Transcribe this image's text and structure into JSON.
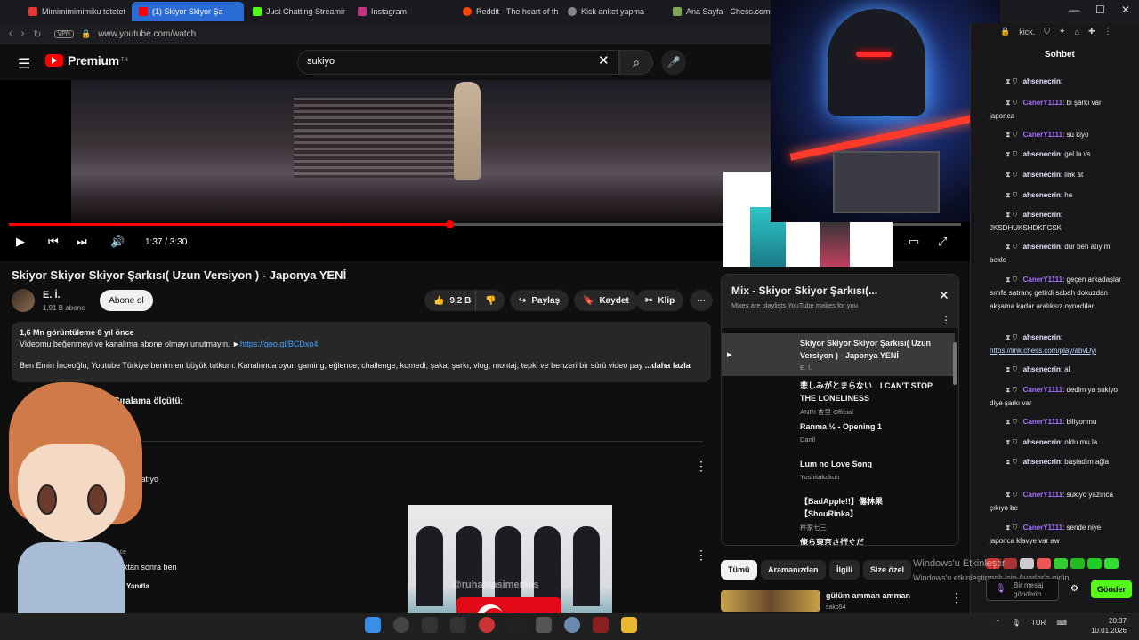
{
  "browser": {
    "tabs": [
      {
        "label": "Mimimimimimiku tetetet",
        "color": "#e53935"
      },
      {
        "label": "(1) Skiyor Skiyor Şa",
        "color": "#ff0000",
        "active": true
      },
      {
        "label": "Just Chatting Streaming",
        "color": "#53fc18"
      },
      {
        "label": "Instagram",
        "color": "#c13584"
      },
      {
        "label": "Reddit - The heart of th",
        "color": "#ff4500"
      },
      {
        "label": "Kick anket yapma",
        "color": "#888888"
      },
      {
        "label": "Ana Sayfa - Chess.com",
        "color": "#7fa650"
      }
    ],
    "vpn_label": "VPN",
    "url": "www.youtube.com/watch",
    "right_url": "kick."
  },
  "youtube": {
    "logo_text": "Premium",
    "logo_region": "TR",
    "search_value": "sukiyo",
    "player": {
      "time": "1:37 / 3:30",
      "progress": 0.463
    },
    "video_title": "Skiyor Skiyor Skiyor Şarkısı( Uzun Versiyon ) - Japonya YENİ",
    "channel": {
      "name": "E. İ.",
      "subs": "1,91 B abone",
      "subscribe_label": "Abone ol"
    },
    "actions": {
      "likes": "9,2 B",
      "share": "Paylaş",
      "save": "Kaydet",
      "clip": "Klip"
    },
    "description": {
      "stats": "1,6 Mn görüntüleme  8 yıl önce",
      "line1": "Videomu beğenmeyi ve kanalıma abone olmayı unutmayın. ►",
      "link": "https://goo.gl/BCDxo4",
      "line2": "Ben Emin İnceoğlu, Youtube Türkiye benim en büyük tutkum. Kanalımda oyun gaming, eğlence, challenge, komedi, şaka, şarkı, vlog, montaj, tepki ve benzeri bir sürü  video pay",
      "more": "...daha fazla"
    },
    "comments": {
      "sort_label": "Sıralama ölçütü:",
      "c1_text": "nini anlatıyo",
      "c2_meta": "8 yıl önce",
      "c2_text": "etime 306 tl yatırdıktan sonra ben",
      "reply_label": "Yanıtla"
    },
    "mix": {
      "title": "Mix - Skiyor Skiyor Şarkısı(...",
      "subtitle": "Mixes are playlists YouTube makes for you",
      "items": [
        {
          "title": "Skiyor Skiyor Skiyor Şarkısı( Uzun Versiyon ) - Japonya YENİ",
          "artist": "E. İ."
        },
        {
          "title": "悲しみがとまらない　I CAN'T STOP THE LONELINESS",
          "artist": "ANRI 杏里 Official"
        },
        {
          "title": "Ranma ½ - Opening 1",
          "artist": "Danil"
        },
        {
          "title": "Lum no Love Song",
          "artist": "Yoshitakakun"
        },
        {
          "title": "【BadApple!!】傷林果【ShouRinka】",
          "artist": "杵家七三"
        },
        {
          "title": "俺ら東京さ行ぐだ",
          "artist": ""
        }
      ]
    },
    "chips": [
      "Tümü",
      "Aramanızdan",
      "İlgili",
      "Size özel"
    ],
    "rec": {
      "title": "gülüm amman amman",
      "channel": "sako54"
    }
  },
  "chat": {
    "header": "Sohbet",
    "messages": [
      {
        "user": "ahsenecrin",
        "text": "",
        "kind": "u1"
      },
      {
        "user": "CanerY1111",
        "text": "bi şarkı var japonca",
        "kind": "u2"
      },
      {
        "user": "CanerY1111",
        "text": "su kiyo",
        "kind": "u2"
      },
      {
        "user": "ahsenecrin",
        "text": "gel la vs",
        "kind": "u1"
      },
      {
        "user": "ahsenecrin",
        "text": "link at",
        "kind": "u1"
      },
      {
        "user": "ahsenecrin",
        "text": "he",
        "kind": "u1"
      },
      {
        "user": "ahsenecrin",
        "text": "JKSDHUKSHDKFCSK",
        "kind": "u1"
      },
      {
        "user": "ahsenecrin",
        "text": "dur ben atıyım bekle",
        "kind": "u1"
      },
      {
        "user": "CanerY1111",
        "text": "geçen arkadaşlar sınıfa satranç getirdi sabah dokuzdan akşama kadar aralıksız oynadılar",
        "kind": "u2"
      },
      {
        "user": "ahsenecrin",
        "text": "https://link.chess.com/play/abvDyi",
        "kind": "u1",
        "link": true
      },
      {
        "user": "ahsenecrin",
        "text": "al",
        "kind": "u1"
      },
      {
        "user": "CanerY1111",
        "text": "dedim ya sukiyo diye şarkı var",
        "kind": "u2"
      },
      {
        "user": "CanerY1111",
        "text": "biliyonmu",
        "kind": "u2"
      },
      {
        "user": "ahsenecrin",
        "text": "oldu mu la",
        "kind": "u1"
      },
      {
        "user": "ahsenecrin",
        "text": "başladım ağla",
        "kind": "u1"
      },
      {
        "user": "CanerY1111",
        "text": "sukiyo yazınca çıkıyo be",
        "kind": "u2"
      },
      {
        "user": "CanerY1111",
        "text": "sende niye japonca klavye var aw",
        "kind": "u2"
      }
    ],
    "input_placeholder": "Bir mesaj gönderin",
    "send_label": "Gönder"
  },
  "windows": {
    "activation_title": "Windows'u Etkinleştir",
    "activation_sub": "Windows'u etkinleştirmek için Ayarlar'a gidin.",
    "lang": "TUR",
    "time": "20:37",
    "date": "10.01.2026"
  },
  "overlay_text": "@ruhastasimemes"
}
